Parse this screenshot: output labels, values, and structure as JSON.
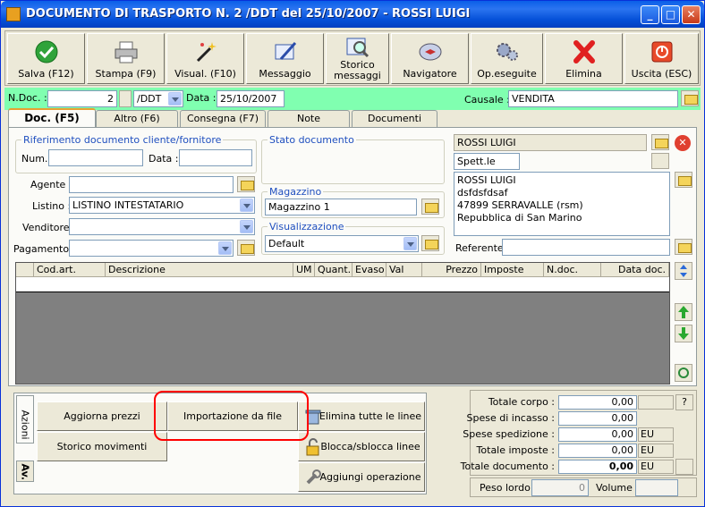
{
  "window": {
    "title": "DOCUMENTO DI TRASPORTO N. 2 /DDT del 25/10/2007 - ROSSI LUIGI",
    "min": "_",
    "max": "□",
    "close": "✕"
  },
  "toolbar": [
    {
      "name": "save",
      "label": "Salva (F12)",
      "icon": "check-icon"
    },
    {
      "name": "print",
      "label": "Stampa (F9)",
      "icon": "printer-icon"
    },
    {
      "name": "preview",
      "label": "Visual. (F10)",
      "icon": "wand-icon"
    },
    {
      "name": "message",
      "label": "Messaggio",
      "icon": "pen-icon"
    },
    {
      "name": "history-messages",
      "label": "Storico messaggi",
      "icon": "magnifier-icon"
    },
    {
      "name": "navigator",
      "label": "Navigatore",
      "icon": "compass-icon"
    },
    {
      "name": "operations",
      "label": "Op.eseguite",
      "icon": "gears-icon"
    },
    {
      "name": "delete",
      "label": "Elimina",
      "icon": "x-icon"
    },
    {
      "name": "exit",
      "label": "Uscita (ESC)",
      "icon": "power-icon"
    }
  ],
  "header": {
    "ndoc_label": "N.Doc. :",
    "ndoc_value": "2",
    "series_value": "/DDT",
    "date_label": "Data :",
    "date_value": "25/10/2007",
    "causale_label": "Causale :",
    "causale_value": "VENDITA"
  },
  "tabs": [
    "Doc. (F5)",
    "Altro (F6)",
    "Consegna (F7)",
    "Note",
    "Documenti"
  ],
  "doc": {
    "rif_title": "Riferimento documento cliente/fornitore",
    "num_label": "Num.:",
    "data_label": "Data :",
    "stato_title": "Stato documento",
    "agente_label": "Agente :",
    "listino_label": "Listino :",
    "listino_value": "LISTINO INTESTATARIO",
    "venditore_label": "Venditore :",
    "pagamento_label": "Pagamento :",
    "magazzino_title": "Magazzino",
    "magazzino_value": "Magazzino 1",
    "visual_title": "Visualizzazione",
    "visual_value": "Default",
    "client_name": "ROSSI LUIGI",
    "spett": "Spett.le",
    "address": [
      "ROSSI LUIGI",
      "dsfdsfdsaf",
      "47899 SERRAVALLE (rsm)",
      "Repubblica di San Marino"
    ],
    "referente_label": "Referente"
  },
  "grid": {
    "columns": [
      "Cod.art.",
      "Descrizione",
      "UM",
      "Quant.",
      "Evaso",
      "Val",
      "Prezzo",
      "Imposte",
      "N.doc.",
      "Data doc."
    ]
  },
  "actions": {
    "tab_azioni": "Azioni",
    "tab_av": "Av.",
    "aggiorna": "Aggiorna prezzi",
    "importazione": "Importazione da file",
    "elimina": "Elimina tutte le linee",
    "storico": "Storico movimenti",
    "blocca": "Blocca/sblocca linee",
    "aggiungi": "Aggiungi operazione"
  },
  "totals": {
    "rows": [
      {
        "label": "Totale corpo :",
        "value": "0,00",
        "unit": ""
      },
      {
        "label": "Spese di incasso :",
        "value": "0,00",
        "unit": ""
      },
      {
        "label": "Spese spedizione :",
        "value": "0,00",
        "unit": "EU"
      },
      {
        "label": "Totale imposte :",
        "value": "0,00",
        "unit": "EU"
      },
      {
        "label": "Totale documento :",
        "value": "0,00",
        "unit": "EU"
      }
    ],
    "help": "?",
    "peso_label": "Peso lordo :",
    "peso_value": "0",
    "volume_label": "Volume :"
  }
}
